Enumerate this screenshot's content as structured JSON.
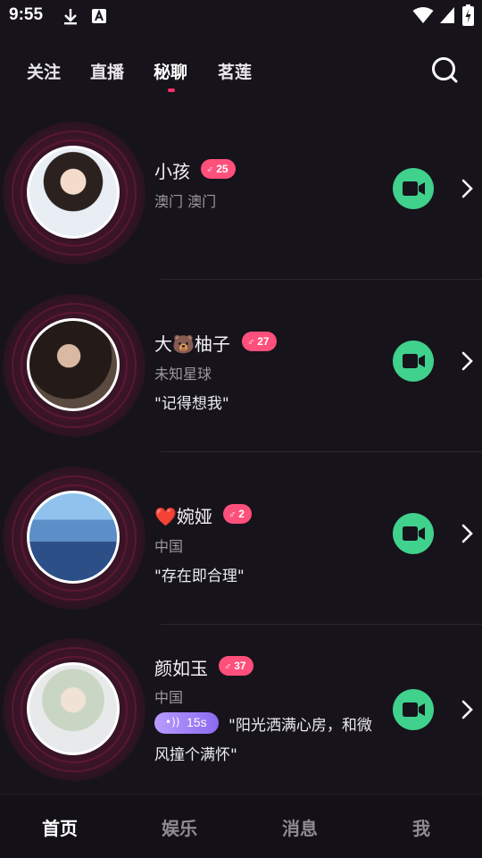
{
  "status_bar": {
    "time": "9:55"
  },
  "top_nav": {
    "tabs": [
      {
        "label": "关注"
      },
      {
        "label": "直播"
      },
      {
        "label": "秘聊"
      },
      {
        "label": "茗莲"
      }
    ],
    "active_tab": "秘聊"
  },
  "users": [
    {
      "name": "小孩",
      "level": "25",
      "location": "澳门 澳门",
      "quote": ""
    },
    {
      "name": "大🐻柚子",
      "level": "27",
      "location": "未知星球",
      "quote": "\"记得想我\""
    },
    {
      "name": "❤️婉娅",
      "level": "2",
      "location": "中国",
      "quote": "\"存在即合理\""
    },
    {
      "name": "颜如玉",
      "level": "37",
      "location": "中国",
      "voice_duration": "15s",
      "quote_line1": "\"阳光洒满心房，和微",
      "quote_line2": "风撞个满怀\""
    }
  ],
  "bottom_nav": {
    "items": [
      {
        "label": "首页"
      },
      {
        "label": "娱乐"
      },
      {
        "label": "消息"
      },
      {
        "label": "我"
      }
    ]
  },
  "colors": {
    "accent": "#ff2e6e",
    "badge": "#ff4f7b",
    "video": "#40d18c",
    "background": "#16131b"
  }
}
